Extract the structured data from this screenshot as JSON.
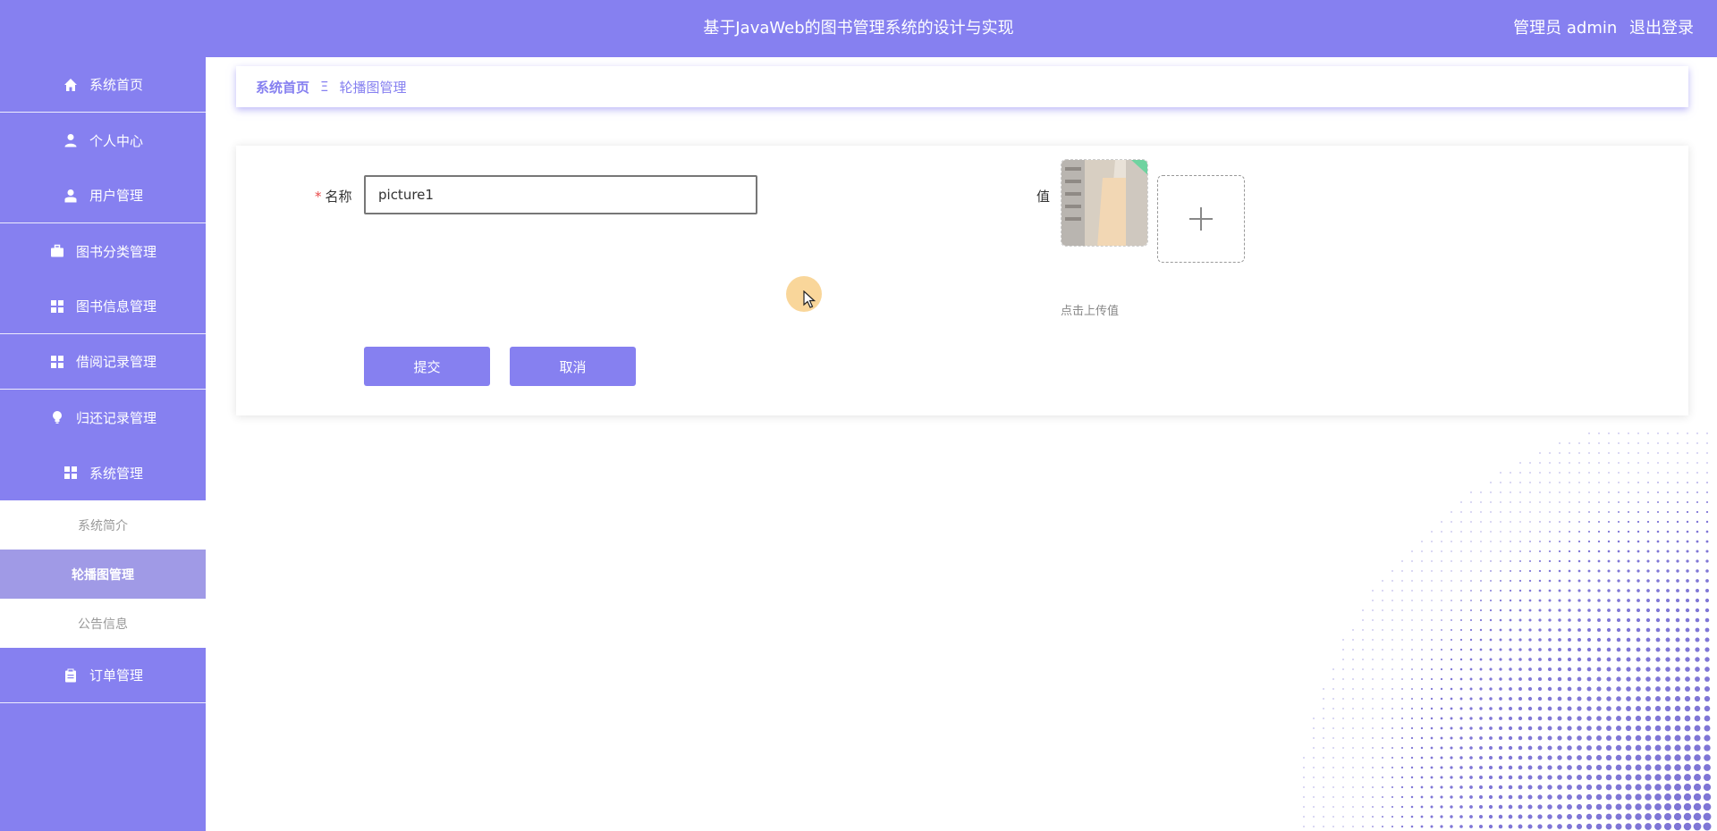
{
  "header": {
    "title": "基于JavaWeb的图书管理系统的设计与实现",
    "user_label": "管理员 admin",
    "logout_label": "退出登录"
  },
  "sidebar": {
    "items": [
      {
        "label": "系统首页",
        "icon": "home-icon"
      },
      {
        "label": "个人中心",
        "icon": "user-icon"
      },
      {
        "label": "用户管理",
        "icon": "user-tie-icon"
      },
      {
        "label": "图书分类管理",
        "icon": "briefcase-icon"
      },
      {
        "label": "图书信息管理",
        "icon": "grid-icon"
      },
      {
        "label": "借阅记录管理",
        "icon": "grid-icon"
      },
      {
        "label": "归还记录管理",
        "icon": "lightbulb-icon"
      },
      {
        "label": "系统管理",
        "icon": "grid-icon"
      },
      {
        "label": "订单管理",
        "icon": "clipboard-icon"
      }
    ],
    "submenu": [
      {
        "label": "系统简介",
        "active": false
      },
      {
        "label": "轮播图管理",
        "active": true
      },
      {
        "label": "公告信息",
        "active": false
      }
    ]
  },
  "breadcrumb": {
    "home": "系统首页",
    "separator": "Ξ",
    "current": "轮播图管理"
  },
  "form": {
    "name_label": "名称",
    "name_required_mark": "*",
    "name_value": "picture1",
    "value_label": "值",
    "upload_hint": "点击上传值",
    "upload_icon": "plus-icon",
    "submit_label": "提交",
    "cancel_label": "取消"
  },
  "colors": {
    "primary": "#8680f0",
    "submenu_active": "#a09ae6",
    "required": "#e84a4a",
    "halftone": "#7f76d6"
  }
}
